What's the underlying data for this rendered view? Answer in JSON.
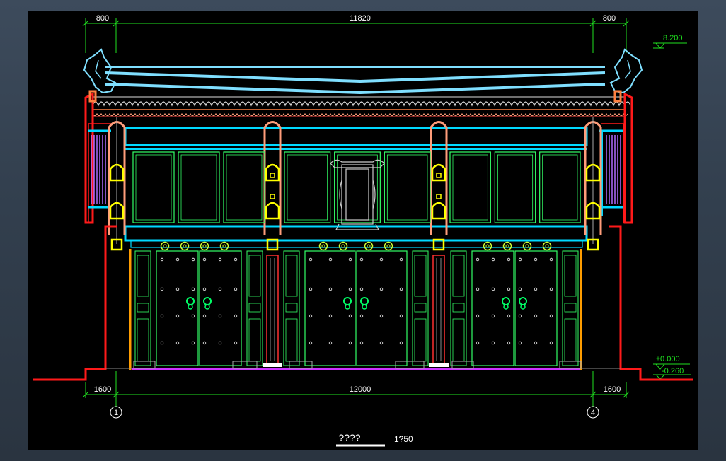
{
  "colors": {
    "background": "#000000",
    "dimension": "#1fe01f",
    "roof": "#7fdfff",
    "beam": "#00d9ff",
    "column": "#ff9d7a",
    "panel": "#33ff66",
    "bracket": "#ffff00",
    "wall": "#ff1a1a",
    "floor": "#cc33ff",
    "rafter": "#b06cff",
    "text": "#ffffff"
  },
  "dimensions": {
    "top_left": "800",
    "top_center": "11820",
    "top_right": "800",
    "bottom_left": "1600",
    "bottom_center": "12000",
    "bottom_right": "1600"
  },
  "elevations": {
    "ridge": "8.200",
    "ground": "±0.000",
    "outside": "-0.260"
  },
  "axes": {
    "left": "1",
    "right": "4"
  },
  "title": {
    "name": "????",
    "scale": "1?50"
  }
}
